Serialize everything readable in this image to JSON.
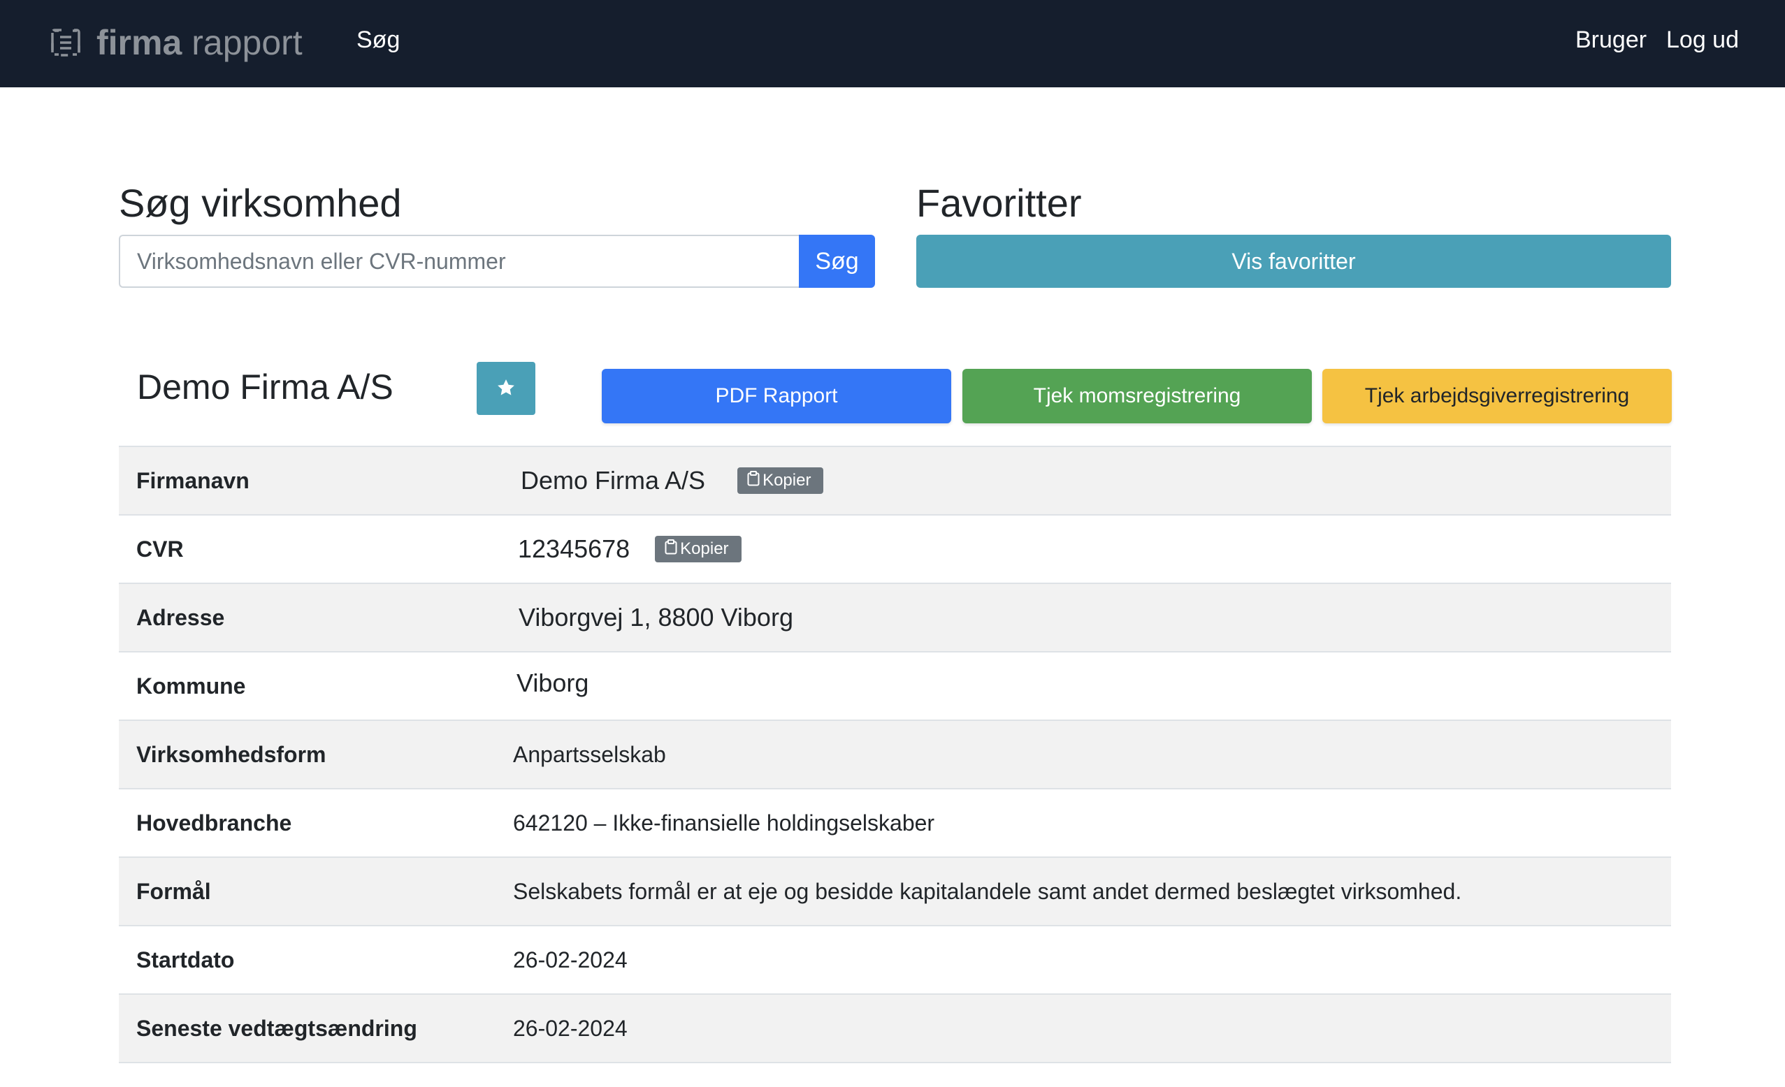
{
  "navbar": {
    "brand_strong": "firma",
    "brand_light": "rapport",
    "brand_icon": "document-list-icon",
    "search_link": "Søg",
    "user_link": "Bruger",
    "logout_link": "Log ud"
  },
  "search": {
    "title": "Søg virksomhed",
    "placeholder": "Virksomhedsnavn eller CVR-nummer",
    "value": "",
    "button_label": "Søg"
  },
  "favorites": {
    "title": "Favoritter",
    "button_label": "Vis favoritter"
  },
  "company": {
    "name": "Demo Firma A/S",
    "favorite_icon": "star-icon",
    "actions": {
      "pdf_label": "PDF Rapport",
      "moms_label": "Tjek momsregistrering",
      "arbejdsgiver_label": "Tjek arbejdsgiverregistrering"
    }
  },
  "table": {
    "copy_label": "Kopier",
    "rows": [
      {
        "label": "Firmanavn",
        "value": "Demo Firma A/S",
        "copy": true
      },
      {
        "label": "CVR",
        "value": "12345678",
        "copy": true
      },
      {
        "label": "Adresse",
        "value": "Viborgvej 1, 8800 Viborg"
      },
      {
        "label": "Kommune",
        "value": "Viborg"
      },
      {
        "label": "Virksomhedsform",
        "value": "Anpartsselskab"
      },
      {
        "label": "Hovedbranche",
        "value": "642120 – Ikke-finansielle holdingselskaber"
      },
      {
        "label": "Formål",
        "value": "Selskabets formål er at eje og besidde kapitalandele samt andet dermed beslægtet virksomhed."
      },
      {
        "label": "Startdato",
        "value": "26-02-2024"
      },
      {
        "label": "Seneste vedtægtsændring",
        "value": "26-02-2024"
      }
    ]
  },
  "colors": {
    "navbar_bg": "#151e2d",
    "primary": "#3476f6",
    "info": "#4aa0b7",
    "success": "#54a354",
    "warning": "#f5c242",
    "secondary": "#6c757d"
  }
}
